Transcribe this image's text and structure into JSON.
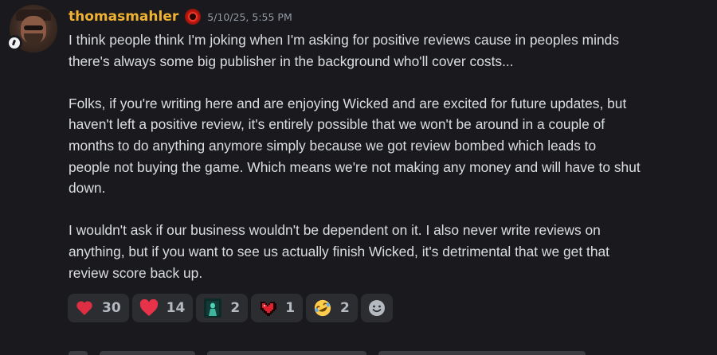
{
  "message": {
    "author": "thomasmahler",
    "timestamp": "5/10/25, 5:55 PM",
    "role_icon": "red-orb-role-icon",
    "avatar": "bearded-man-avatar",
    "status": "idle-status-badge",
    "paragraphs": [
      [
        "I think people think I'm joking when I'm asking for positive reviews cause in peoples minds",
        "there's always some big publisher in the background who'll cover costs..."
      ],
      [
        "Folks, if you're writing here and are enjoying Wicked and are excited for future updates, but",
        "haven't left a positive review, it's entirely possible that we won't be around in a couple of",
        "months to do anything anymore simply because we got review bombed which leads to",
        "people not buying the game. Which means we're not making any money and will have to shut",
        "down."
      ],
      [
        "I wouldn't ask if our business wouldn't be dependent on it. I also never write reviews on",
        "anything, but if you want to see us actually finish Wicked, it's detrimental that we get that",
        "review score back up."
      ]
    ]
  },
  "reactions": [
    {
      "icon": "red-heart-icon",
      "count": "30"
    },
    {
      "icon": "heart-icon",
      "count": "14"
    },
    {
      "icon": "ghost-figure-icon",
      "count": "2"
    },
    {
      "icon": "pixel-heart-icon",
      "count": "1"
    },
    {
      "icon": "rolling-laughing-icon",
      "count": "2"
    }
  ],
  "add_reaction_icon": "add-reaction-smiley-icon",
  "colors": {
    "background": "#1a1a1e",
    "username": "#f0b232",
    "text": "#dbdee1",
    "timestamp": "#949ba4",
    "reaction_bg": "#2b2d31",
    "reaction_count": "#b5bac1"
  }
}
